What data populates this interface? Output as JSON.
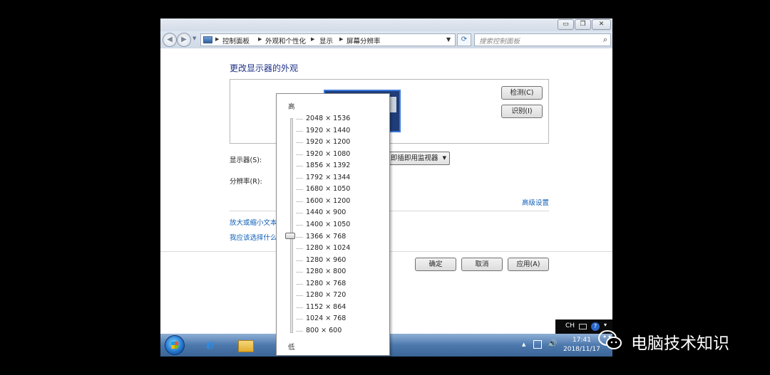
{
  "window": {
    "min_icon": "minimize-icon",
    "max_icon": "maximize-icon",
    "close_icon": "close-icon",
    "min_glyph": "▭",
    "max_glyph": "❐",
    "close_glyph": "✕"
  },
  "addressbar": {
    "back_glyph": "◀",
    "fwd_glyph": "▶",
    "breadcrumbs": [
      "控制面板",
      "外观和个性化",
      "显示",
      "屏幕分辨率"
    ],
    "refresh_glyph": "⟳",
    "search_placeholder": "搜索控制面板",
    "search_glyph": "⌕"
  },
  "main": {
    "title": "更改显示器的外观",
    "detect_label": "检测(C)",
    "identify_label": "识别(I)",
    "display_label": "显示器(S):",
    "display_value": "即插即用监视器",
    "resolution_label": "分辨率(R):",
    "advanced_link": "高级设置",
    "link1": "放大或缩小文本",
    "link2": "我应该选择什么",
    "ok_label": "确定",
    "cancel_label": "取消",
    "apply_label": "应用(A)"
  },
  "resolution_popup": {
    "high_label": "高",
    "low_label": "低",
    "options": [
      "2048 × 1536",
      "1920 × 1440",
      "1920 × 1200",
      "1920 × 1080",
      "1856 × 1392",
      "1792 × 1344",
      "1680 × 1050",
      "1600 × 1200",
      "1440 × 900",
      "1400 × 1050",
      "1366 × 768",
      "1280 × 1024",
      "1280 × 960",
      "1280 × 800",
      "1280 × 768",
      "1280 × 720",
      "1152 × 864",
      "1024 × 768",
      "800 × 600"
    ],
    "selected": "1366 × 768"
  },
  "taskbar": {
    "ie_glyph": "e",
    "tray_up_glyph": "▲",
    "volume_glyph": "🔊",
    "time": "17:41",
    "date": "2018/11/17"
  },
  "langbar": {
    "lang": "CH",
    "help_glyph": "?",
    "opt_glyph": "▾"
  },
  "watermark": {
    "text": "电脑技术知识"
  }
}
